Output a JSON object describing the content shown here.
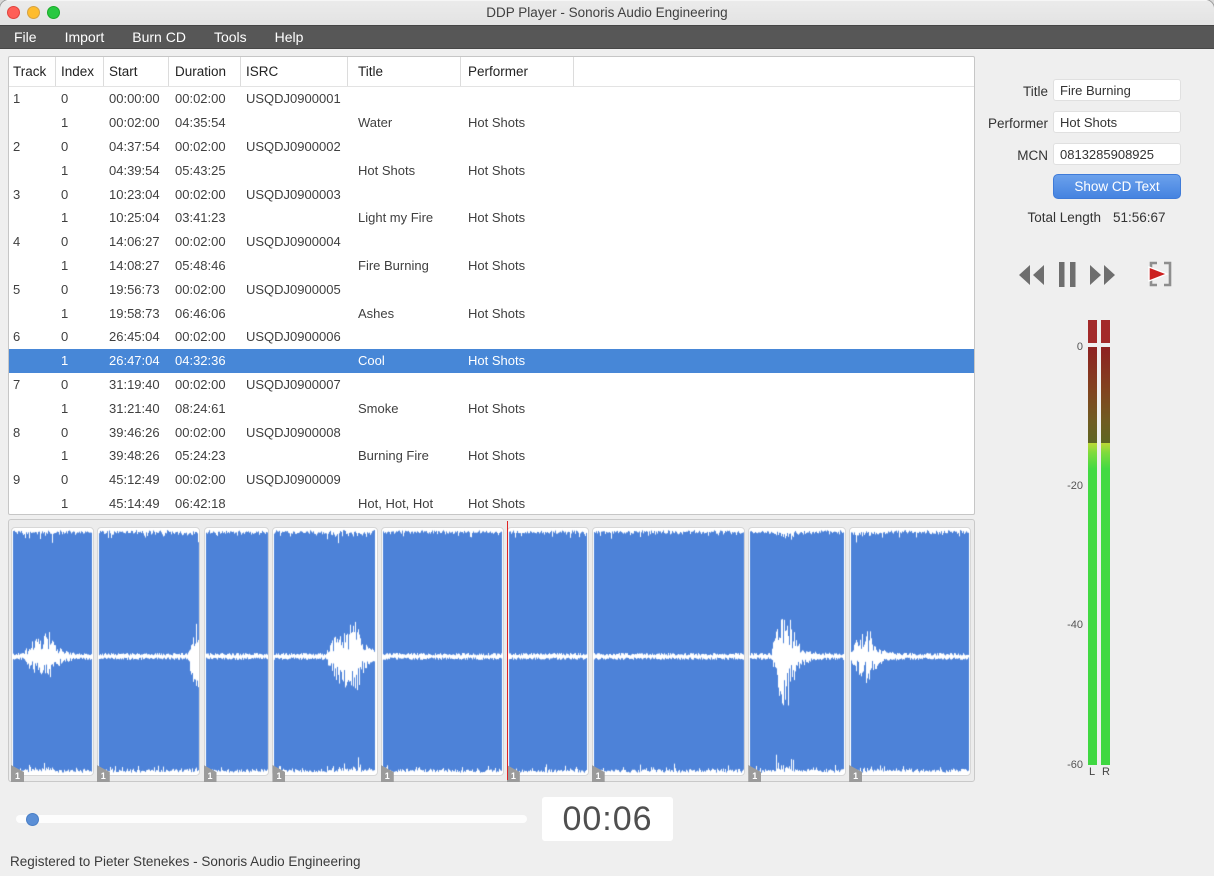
{
  "window": {
    "title": "DDP Player - Sonoris Audio Engineering"
  },
  "menu": {
    "items": [
      {
        "label": "File"
      },
      {
        "label": "Import"
      },
      {
        "label": "Burn CD"
      },
      {
        "label": "Tools"
      },
      {
        "label": "Help"
      }
    ]
  },
  "table": {
    "columns": [
      "Track",
      "Index",
      "Start",
      "Duration",
      "ISRC",
      "Title",
      "Performer"
    ],
    "rows": [
      {
        "track": "1",
        "index": "0",
        "start": "00:00:00",
        "duration": "00:02:00",
        "isrc": "USQDJ0900001",
        "title": "",
        "performer": "",
        "selected": false
      },
      {
        "track": "",
        "index": "1",
        "start": "00:02:00",
        "duration": "04:35:54",
        "isrc": "",
        "title": "Water",
        "performer": "Hot Shots",
        "selected": false
      },
      {
        "track": "2",
        "index": "0",
        "start": "04:37:54",
        "duration": "00:02:00",
        "isrc": "USQDJ0900002",
        "title": "",
        "performer": "",
        "selected": false
      },
      {
        "track": "",
        "index": "1",
        "start": "04:39:54",
        "duration": "05:43:25",
        "isrc": "",
        "title": "Hot Shots",
        "performer": "Hot Shots",
        "selected": false
      },
      {
        "track": "3",
        "index": "0",
        "start": "10:23:04",
        "duration": "00:02:00",
        "isrc": "USQDJ0900003",
        "title": "",
        "performer": "",
        "selected": false
      },
      {
        "track": "",
        "index": "1",
        "start": "10:25:04",
        "duration": "03:41:23",
        "isrc": "",
        "title": "Light my Fire",
        "performer": "Hot Shots",
        "selected": false
      },
      {
        "track": "4",
        "index": "0",
        "start": "14:06:27",
        "duration": "00:02:00",
        "isrc": "USQDJ0900004",
        "title": "",
        "performer": "",
        "selected": false
      },
      {
        "track": "",
        "index": "1",
        "start": "14:08:27",
        "duration": "05:48:46",
        "isrc": "",
        "title": "Fire Burning",
        "performer": "Hot Shots",
        "selected": false
      },
      {
        "track": "5",
        "index": "0",
        "start": "19:56:73",
        "duration": "00:02:00",
        "isrc": "USQDJ0900005",
        "title": "",
        "performer": "",
        "selected": false
      },
      {
        "track": "",
        "index": "1",
        "start": "19:58:73",
        "duration": "06:46:06",
        "isrc": "",
        "title": "Ashes",
        "performer": "Hot Shots",
        "selected": false
      },
      {
        "track": "6",
        "index": "0",
        "start": "26:45:04",
        "duration": "00:02:00",
        "isrc": "USQDJ0900006",
        "title": "",
        "performer": "",
        "selected": false
      },
      {
        "track": "",
        "index": "1",
        "start": "26:47:04",
        "duration": "04:32:36",
        "isrc": "",
        "title": "Cool",
        "performer": "Hot Shots",
        "selected": true
      },
      {
        "track": "7",
        "index": "0",
        "start": "31:19:40",
        "duration": "00:02:00",
        "isrc": "USQDJ0900007",
        "title": "",
        "performer": "",
        "selected": false
      },
      {
        "track": "",
        "index": "1",
        "start": "31:21:40",
        "duration": "08:24:61",
        "isrc": "",
        "title": "Smoke",
        "performer": "Hot Shots",
        "selected": false
      },
      {
        "track": "8",
        "index": "0",
        "start": "39:46:26",
        "duration": "00:02:00",
        "isrc": "USQDJ0900008",
        "title": "",
        "performer": "",
        "selected": false
      },
      {
        "track": "",
        "index": "1",
        "start": "39:48:26",
        "duration": "05:24:23",
        "isrc": "",
        "title": "Burning Fire",
        "performer": "Hot Shots",
        "selected": false
      },
      {
        "track": "9",
        "index": "0",
        "start": "45:12:49",
        "duration": "00:02:00",
        "isrc": "USQDJ0900009",
        "title": "",
        "performer": "",
        "selected": false
      },
      {
        "track": "",
        "index": "1",
        "start": "45:14:49",
        "duration": "06:42:18",
        "isrc": "",
        "title": "Hot, Hot, Hot",
        "performer": "Hot Shots",
        "selected": false
      }
    ]
  },
  "cd_text": {
    "title_label": "Title",
    "title_value": "Fire Burning",
    "performer_label": "Performer",
    "performer_value": "Hot Shots",
    "mcn_label": "MCN",
    "mcn_value": "0813285908925",
    "button_label": "Show CD Text",
    "total_length_label": "Total Length",
    "total_length_value": "51:56:67"
  },
  "transport": {
    "icons": [
      "rewind-icon",
      "pause-icon",
      "fast-forward-icon",
      "play-to-marker-icon"
    ]
  },
  "meter": {
    "scale_labels": [
      "0",
      "-20",
      "-40",
      "-60"
    ],
    "channel_labels": [
      "L",
      "R"
    ],
    "level_note": "bright portion below approx -14 dB, clip segments lit"
  },
  "waveform": {
    "marker_label": "1",
    "playhead_frac": 0.515,
    "segments": [
      {
        "track": 1,
        "frac": 0.0891
      },
      {
        "track": 2,
        "frac": 0.1108
      },
      {
        "track": 3,
        "frac": 0.0716
      },
      {
        "track": 4,
        "frac": 0.1125
      },
      {
        "track": 5,
        "frac": 0.1309
      },
      {
        "track": 6,
        "frac": 0.0881
      },
      {
        "track": 7,
        "frac": 0.1626
      },
      {
        "track": 8,
        "frac": 0.1047
      },
      {
        "track": 9,
        "frac": 0.1297
      }
    ]
  },
  "player": {
    "time_display": "00:06",
    "slider_frac": 0.02
  },
  "status_bar": {
    "text": "Registered to Pieter Stenekes - Sonoris Audio Engineering"
  },
  "colors": {
    "selection_blue": "#4787d7",
    "waveform_blue": "#4d82d8",
    "button_blue": "#4583e0",
    "playhead_red": "#e02424",
    "traffic_red": "#ff5f57",
    "traffic_yellow": "#febc2e",
    "traffic_green": "#28c840"
  }
}
